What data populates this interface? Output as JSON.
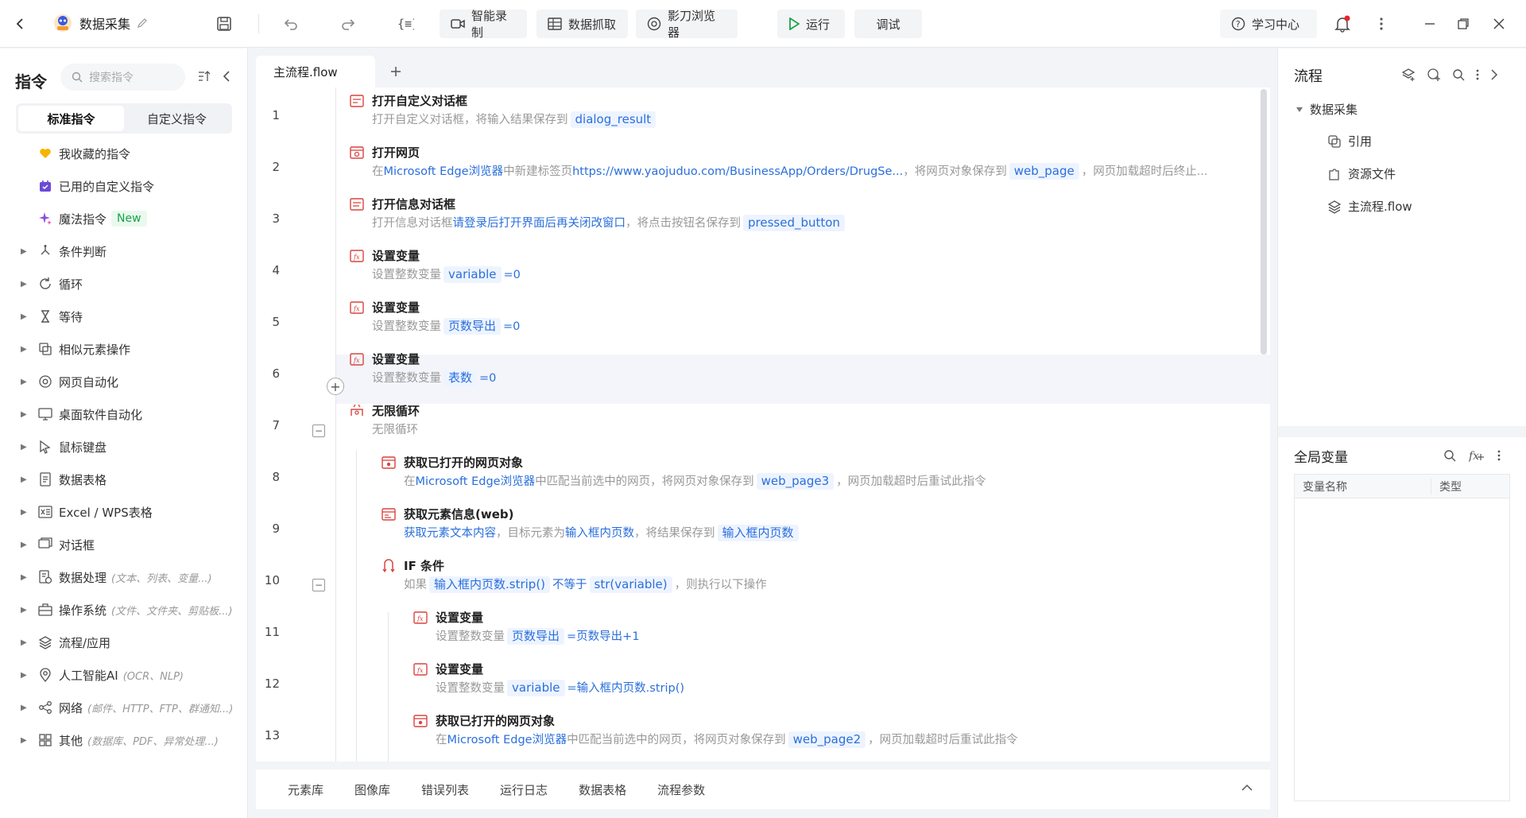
{
  "topbar": {
    "app_name": "数据采集",
    "buttons": {
      "smart_record": "智能录制",
      "data_capture": "数据抓取",
      "shadow_browser": "影刀浏览器",
      "run": "运行",
      "debug": "调试",
      "learning_center": "学习中心"
    }
  },
  "left_panel": {
    "title": "指令",
    "search_placeholder": "搜索指令",
    "tabs": [
      "标准指令",
      "自定义指令"
    ],
    "special_items": [
      {
        "label": "我收藏的指令",
        "icon": "heart-icon"
      },
      {
        "label": "已用的自定义指令",
        "icon": "calendar-check-icon"
      },
      {
        "label": "魔法指令",
        "icon": "sparkle-icon",
        "badge": "New"
      }
    ],
    "groups": [
      {
        "label": "条件判断",
        "icon": "branch-icon",
        "hint": ""
      },
      {
        "label": "循环",
        "icon": "loop-icon",
        "hint": ""
      },
      {
        "label": "等待",
        "icon": "hourglass-icon",
        "hint": ""
      },
      {
        "label": "相似元素操作",
        "icon": "copy-element-icon",
        "hint": ""
      },
      {
        "label": "网页自动化",
        "icon": "browser-icon",
        "hint": ""
      },
      {
        "label": "桌面软件自动化",
        "icon": "monitor-icon",
        "hint": ""
      },
      {
        "label": "鼠标键盘",
        "icon": "cursor-icon",
        "hint": ""
      },
      {
        "label": "数据表格",
        "icon": "document-icon",
        "hint": ""
      },
      {
        "label": "Excel / WPS表格",
        "icon": "excel-icon",
        "hint": ""
      },
      {
        "label": "对话框",
        "icon": "dialog-icon",
        "hint": ""
      },
      {
        "label": "数据处理",
        "icon": "data-process-icon",
        "hint": "(文本、列表、变量...)"
      },
      {
        "label": "操作系统",
        "icon": "toolbox-icon",
        "hint": "(文件、文件夹、剪贴板...)"
      },
      {
        "label": "流程/应用",
        "icon": "layers-icon",
        "hint": ""
      },
      {
        "label": "人工智能AI",
        "icon": "ai-location-icon",
        "hint": "(OCR、NLP)"
      },
      {
        "label": "网络",
        "icon": "share-icon",
        "hint": "(邮件、HTTP、FTP、群通知...)"
      },
      {
        "label": "其他",
        "icon": "grid-icon",
        "hint": "(数据库、PDF、异常处理...)"
      }
    ]
  },
  "editor": {
    "tab": "主流程.flow",
    "lines": [
      {
        "n": "1",
        "title": "打开自定义对话框",
        "desc": [
          [
            "t",
            "打开自定义对话框，将输入结果保存到"
          ],
          [
            "p",
            "dialog_result"
          ]
        ]
      },
      {
        "n": "2",
        "title": "打开网页",
        "desc": [
          [
            "t",
            "在"
          ],
          [
            "l",
            "Microsoft Edge浏览器"
          ],
          [
            "t",
            "中新建标签页"
          ],
          [
            "l",
            "https://www.yaojuduo.com/BusinessApp/Orders/DrugSe..."
          ],
          [
            "t",
            "，将网页对象保存到"
          ],
          [
            "p",
            "web_page"
          ],
          [
            "t",
            "，网页加载超时后终止..."
          ]
        ]
      },
      {
        "n": "3",
        "title": "打开信息对话框",
        "desc": [
          [
            "t",
            "打开信息对话框"
          ],
          [
            "l",
            "请登录后打开界面后再关闭改窗口"
          ],
          [
            "t",
            "，将点击按钮名保存到"
          ],
          [
            "p",
            "pressed_button"
          ]
        ]
      },
      {
        "n": "4",
        "title": "设置变量",
        "desc": [
          [
            "t",
            "设置整数变量"
          ],
          [
            "p",
            "variable"
          ],
          [
            "l",
            "=0"
          ]
        ]
      },
      {
        "n": "5",
        "title": "设置变量",
        "desc": [
          [
            "t",
            "设置整数变量"
          ],
          [
            "p",
            "页数导出"
          ],
          [
            "l",
            "=0"
          ]
        ]
      },
      {
        "n": "6",
        "title": "设置变量",
        "desc": [
          [
            "t",
            "设置整数变量"
          ],
          [
            "p",
            "表数"
          ],
          [
            "l",
            "=0"
          ]
        ]
      },
      {
        "n": "7",
        "title": "无限循环",
        "desc": [
          [
            "t",
            "无限循环"
          ]
        ]
      },
      {
        "n": "8",
        "title": "获取已打开的网页对象",
        "desc": [
          [
            "t",
            "在"
          ],
          [
            "l",
            "Microsoft Edge浏览器"
          ],
          [
            "t",
            "中匹配当前选中的网页，将网页对象保存到"
          ],
          [
            "p",
            "web_page3"
          ],
          [
            "t",
            "，网页加载超时后重试此指令"
          ]
        ]
      },
      {
        "n": "9",
        "title": "获取元素信息(web)",
        "desc": [
          [
            "l",
            "获取元素文本内容"
          ],
          [
            "t",
            "，目标元素为"
          ],
          [
            "l",
            "输入框内页数"
          ],
          [
            "t",
            "，将结果保存到"
          ],
          [
            "p",
            "输入框内页数"
          ]
        ]
      },
      {
        "n": "10",
        "title": "IF 条件",
        "desc": [
          [
            "t",
            "如果"
          ],
          [
            "p",
            "输入框内页数.strip()"
          ],
          [
            "l",
            "不等于"
          ],
          [
            "p",
            "str(variable)"
          ],
          [
            "t",
            "，则执行以下操作"
          ]
        ]
      },
      {
        "n": "11",
        "title": "设置变量",
        "desc": [
          [
            "t",
            "设置整数变量"
          ],
          [
            "p",
            "页数导出"
          ],
          [
            "l",
            "=页数导出+1"
          ]
        ]
      },
      {
        "n": "12",
        "title": "设置变量",
        "desc": [
          [
            "t",
            "设置整数变量"
          ],
          [
            "p",
            "variable"
          ],
          [
            "l",
            "=输入框内页数.strip()"
          ]
        ]
      },
      {
        "n": "13",
        "title": "获取已打开的网页对象",
        "desc": [
          [
            "t",
            "在"
          ],
          [
            "l",
            "Microsoft Edge浏览器"
          ],
          [
            "t",
            "中匹配当前选中的网页，将网页对象保存到"
          ],
          [
            "p",
            "web_page2"
          ],
          [
            "t",
            "，网页加载超时后重试此指令"
          ]
        ]
      }
    ]
  },
  "bottom_tabs": [
    "元素库",
    "图像库",
    "错误列表",
    "运行日志",
    "数据表格",
    "流程参数"
  ],
  "right_panel": {
    "flow_title": "流程",
    "tree_root": "数据采集",
    "tree_children": [
      "引用",
      "资源文件",
      "主流程.flow"
    ],
    "vars_title": "全局变量",
    "var_columns": [
      "变量名称",
      "类型"
    ]
  },
  "colors": {
    "accent": "#2a6fdc",
    "badge_green": "#1ba34a",
    "step_icon": "#d9453f",
    "notif_dot": "#e5252a"
  }
}
